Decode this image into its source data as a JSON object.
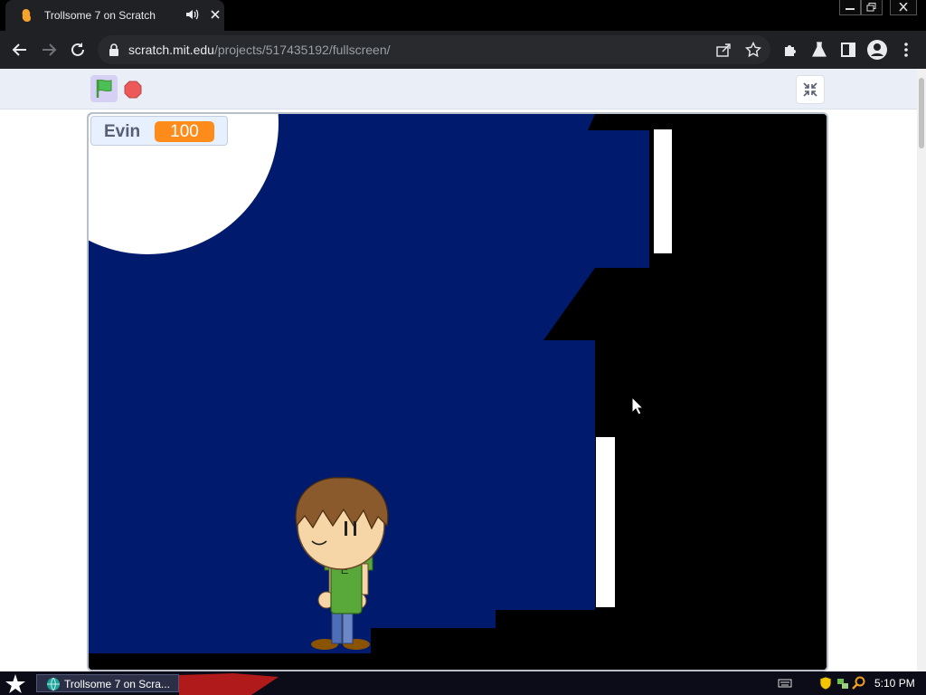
{
  "browser": {
    "tab_title": "Trollsome 7 on Scratch",
    "url_host": "scratch.mit.edu",
    "url_path": "/projects/517435192/fullscreen/"
  },
  "scratch": {
    "variable": {
      "name": "Evin",
      "value": "100"
    },
    "character_shirt_letter": "E"
  },
  "taskbar": {
    "task_label": "Trollsome 7 on Scra...",
    "clock": "5:10 PM"
  },
  "colors": {
    "sky": "#001a6e",
    "variable_value_bg": "#ff8c1a",
    "flag_green": "#4cbf56",
    "stop_red": "#ec5959"
  }
}
